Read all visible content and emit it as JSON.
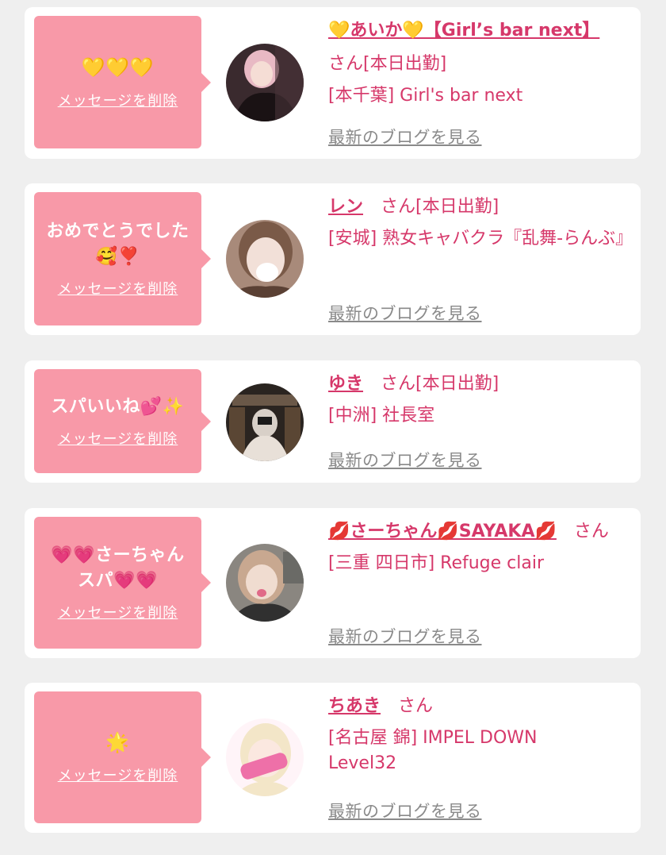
{
  "delete_label": "メッセージを削除",
  "san_label": "さん",
  "blog_label": "最新のブログを見る",
  "entries": [
    {
      "message": "💛💛💛",
      "name": "💛あいか💛【Girl’s bar next】",
      "status": "さん[本日出勤]",
      "shop": "[本千葉] Girl's bar next",
      "avatar_colors": [
        "#3a2a2e",
        "#e8b9c4",
        "#1a1214"
      ]
    },
    {
      "message": "おめでとうでした🥰❣️",
      "name": "レン",
      "status": "[本日出勤]",
      "shop": "[安城] 熟女キャバクラ『乱舞-らんぶ』",
      "avatar_colors": [
        "#a88a7a",
        "#f2e6e2",
        "#5a4034"
      ]
    },
    {
      "message": "スパいいね💕✨",
      "name": "ゆき",
      "status": "[本日出勤]",
      "shop": "[中洲] 社長室",
      "avatar_colors": [
        "#2a2420",
        "#d8d0c8",
        "#4a3a30"
      ]
    },
    {
      "message": "💗💗さーちゃんスパ💗💗",
      "name": "💋さーちゃん💋SAYAKA💋",
      "status": "",
      "shop": "[三重 四日市] Refuge clair",
      "avatar_colors": [
        "#8a8680",
        "#f0dcd0",
        "#303030"
      ]
    },
    {
      "message": "🌟",
      "name": "ちあき",
      "status": "",
      "shop": "[名古屋 錦] IMPEL DOWN Level32",
      "avatar_colors": [
        "#f3e6c8",
        "#ee70a8",
        "#fff4f8"
      ]
    }
  ]
}
